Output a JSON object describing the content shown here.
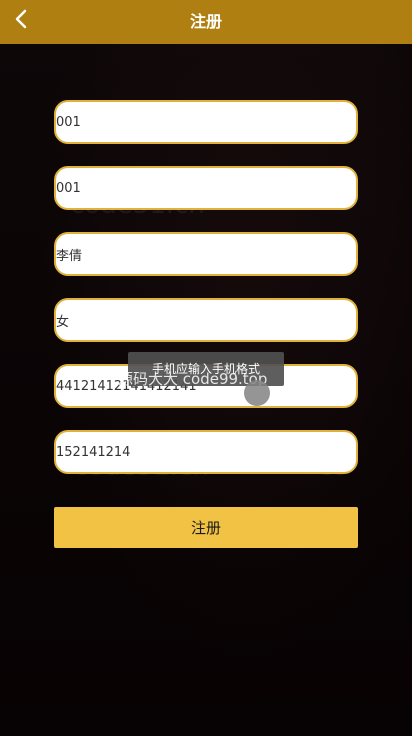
{
  "header": {
    "title": "注册"
  },
  "form": {
    "fields": [
      {
        "value": "001"
      },
      {
        "value": "001"
      },
      {
        "value": "李倩"
      },
      {
        "value": "女"
      },
      {
        "value": "44121412141412141"
      },
      {
        "value": "152141214"
      }
    ],
    "submit_label": "注册"
  },
  "toast": {
    "message": "手机应输入手机格式"
  },
  "watermarks": {
    "main": "源码大大 code99.top",
    "faint_1": "code51.cn",
    "faint_2": "code51.cn",
    "faint_3": "code51.cn",
    "faint_4": "co"
  },
  "colors": {
    "header": "#b07f11",
    "field_border": "#e0b23b",
    "submit_bg": "#f1c244",
    "background": "#0b0506"
  }
}
